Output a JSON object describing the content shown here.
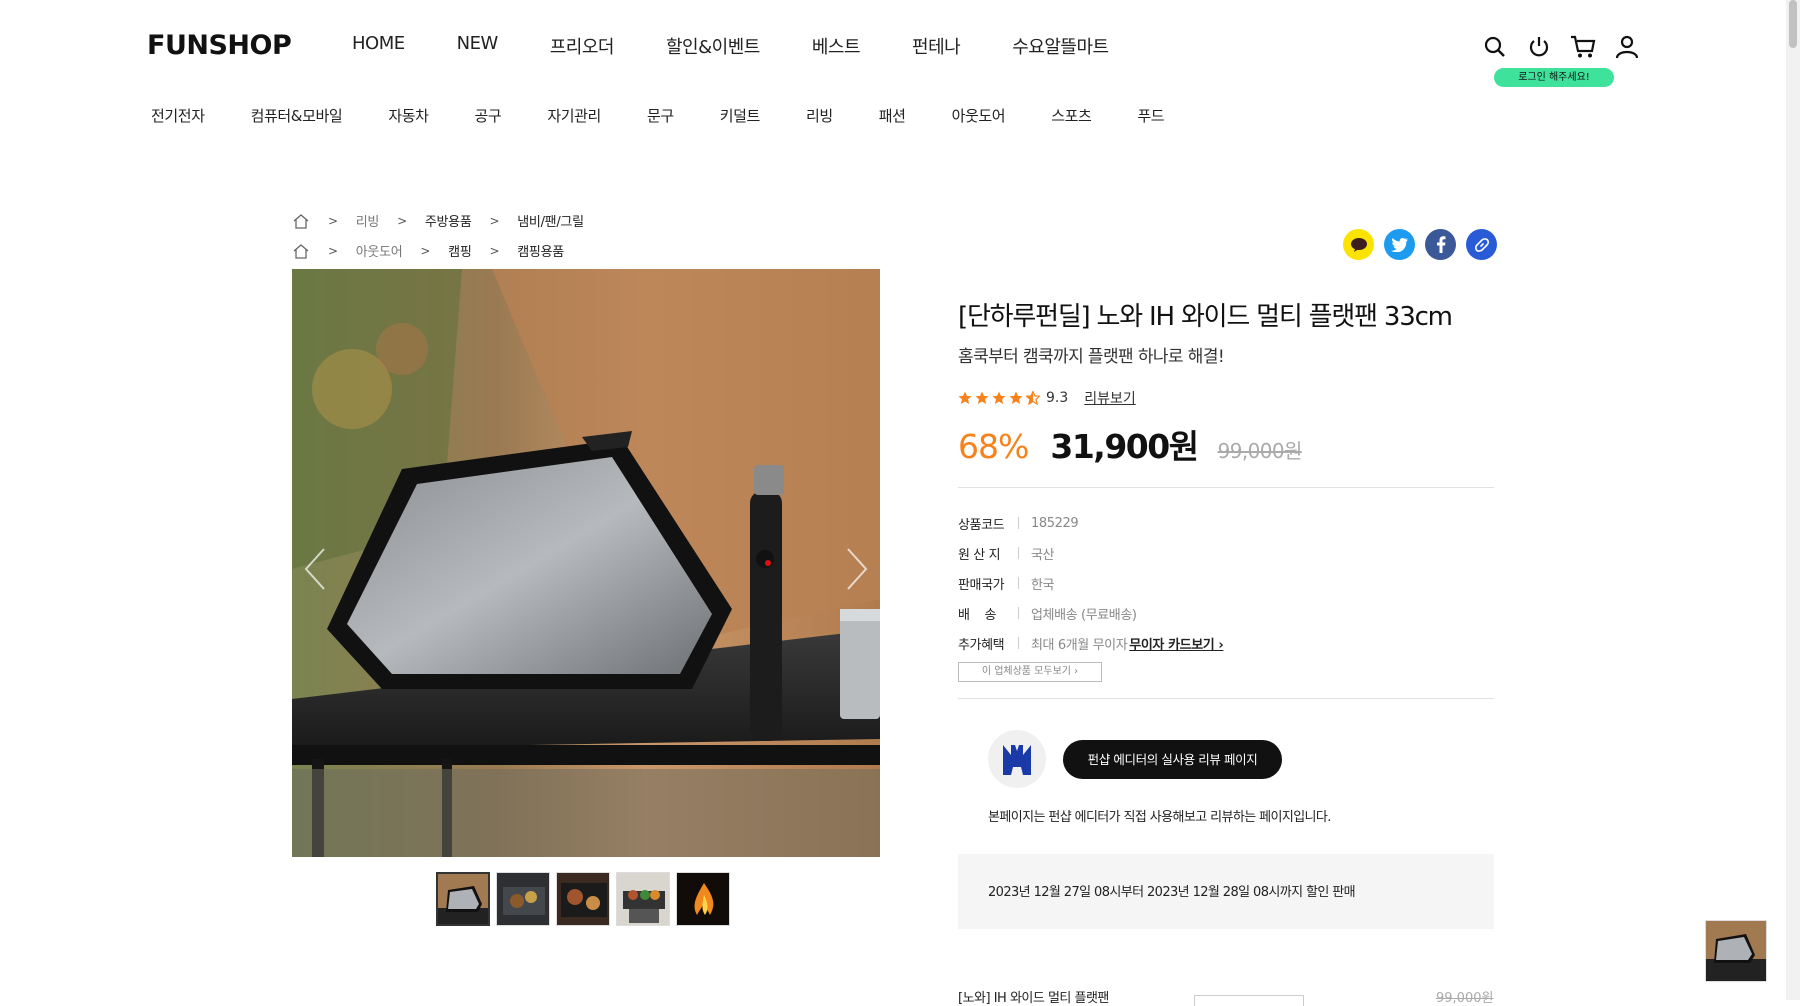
{
  "header": {
    "logo": "FUNSHOP",
    "nav": [
      "HOME",
      "NEW",
      "프리오더",
      "할인&이벤트",
      "베스트",
      "펀테나",
      "수요알뜰마트"
    ],
    "icons": [
      "search-icon",
      "power-icon",
      "cart-icon",
      "user-icon"
    ],
    "login_badge": "로그인 해주세요!"
  },
  "categories": [
    "전기전자",
    "컴퓨터&모바일",
    "자동차",
    "공구",
    "자기관리",
    "문구",
    "키덜트",
    "리빙",
    "패션",
    "아웃도어",
    "스포츠",
    "푸드"
  ],
  "breadcrumbs": [
    [
      "리빙",
      "주방용품",
      "냄비/팬/그릴"
    ],
    [
      "아웃도어",
      "캠핑",
      "캠핑용품"
    ]
  ],
  "share": {
    "icons": [
      "kakao-icon",
      "twitter-icon",
      "facebook-icon",
      "link-icon"
    ]
  },
  "product": {
    "title": "[단하루펀딜] 노와 IH 와이드 멀티 플랫팬 33cm",
    "subtitle": "홈쿡부터 캠쿡까지 플랫팬 하나로 해결!",
    "rating": "9.3",
    "rating_stars": 4.5,
    "review_link": "리뷰보기",
    "discount": "68%",
    "price": "31,900원",
    "original_price": "99,000원",
    "specs": [
      {
        "label": "상품코드",
        "value": "185229"
      },
      {
        "label": "원 산 지",
        "value": "국산"
      },
      {
        "label": "판매국가",
        "value": "한국"
      },
      {
        "label": "배    송",
        "value": "업체배송 (무료배송)"
      },
      {
        "label": "추가혜택",
        "value": "최대 6개월 무이자",
        "link": "무이자 카드보기 ›"
      }
    ],
    "vendor_button": "이 업체상품 모두보기  ›",
    "editor_button": "펀샵 에디터의 실사용 리뷰 페이지",
    "editor_note": "본페이지는 펀샵 에디터가 직접 사용해보고 리뷰하는 페이지입니다.",
    "sale_period": "2023년 12월 27일 08시부터 2023년 12월 28일 08시까지 할인 판매",
    "option_name": "[노와] IH 와이드 멀티 플랫팬",
    "option_price": "99,000원",
    "thumbnail_count": 5,
    "colors": {
      "accent": "#f7821b",
      "badge": "#3ee29a"
    }
  }
}
